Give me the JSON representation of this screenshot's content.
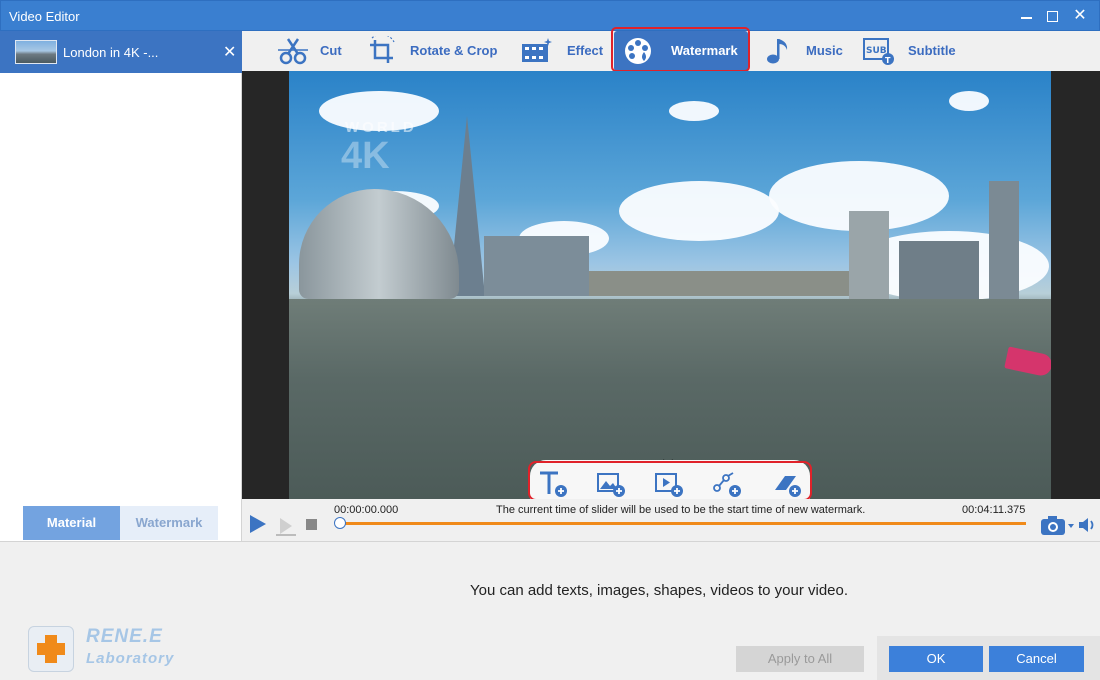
{
  "window": {
    "title": "Video Editor"
  },
  "file": {
    "name": "London in 4K -..."
  },
  "left_tabs": {
    "material": "Material",
    "watermark": "Watermark"
  },
  "toolbar": [
    {
      "label": "Cut",
      "icon": "cut-icon"
    },
    {
      "label": "Rotate & Crop",
      "icon": "rotate-crop-icon"
    },
    {
      "label": "Effect",
      "icon": "effect-icon"
    },
    {
      "label": "Watermark",
      "icon": "watermark-icon",
      "active": true
    },
    {
      "label": "Music",
      "icon": "music-icon"
    },
    {
      "label": "Subtitle",
      "icon": "subtitle-icon"
    }
  ],
  "video": {
    "watermark_text": "WORLD",
    "watermark_big": "4K"
  },
  "watermark_tools": [
    "add-text-icon",
    "add-image-icon",
    "add-video-icon",
    "add-shape-icon",
    "add-eraser-icon"
  ],
  "playback": {
    "time_start": "00:00:00.000",
    "time_end": "00:04:11.375",
    "hint": "The current time of slider will be used to be the start time of new watermark."
  },
  "info": "You can add texts, images, shapes, videos to your video.",
  "logo": {
    "line1": "RENE.E",
    "line2": "Laboratory"
  },
  "buttons": {
    "apply": "Apply to All",
    "ok": "OK",
    "cancel": "Cancel"
  },
  "colors": {
    "accent": "#3c74c2",
    "highlight": "#e0222a",
    "progress": "#f08a1a"
  }
}
